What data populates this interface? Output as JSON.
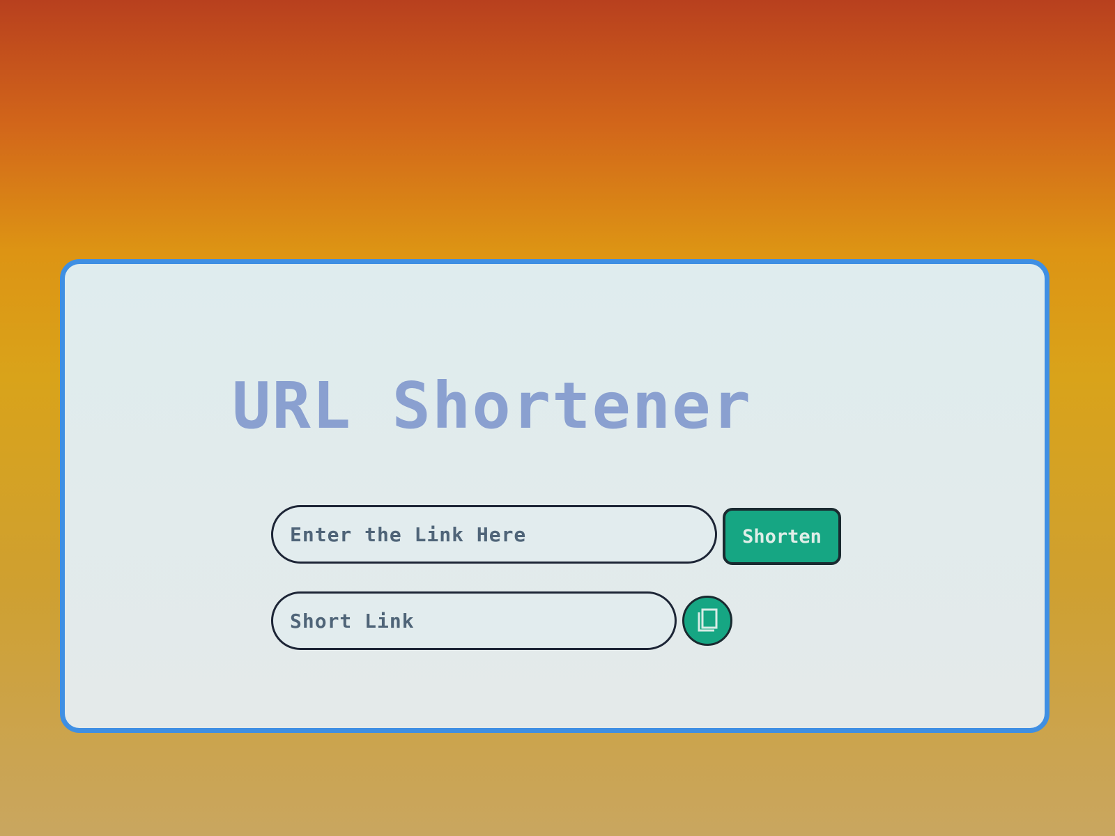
{
  "title": "URL Shortener",
  "long_input": {
    "placeholder": "Enter the Link Here",
    "value": ""
  },
  "shorten_button": "Shorten",
  "short_input": {
    "placeholder": "Short Link",
    "value": ""
  },
  "copy_button": {
    "icon": "copy-icon"
  },
  "colors": {
    "accent": "#16a683",
    "card_border": "#3f8fe3",
    "title": "#8aa0d0"
  }
}
